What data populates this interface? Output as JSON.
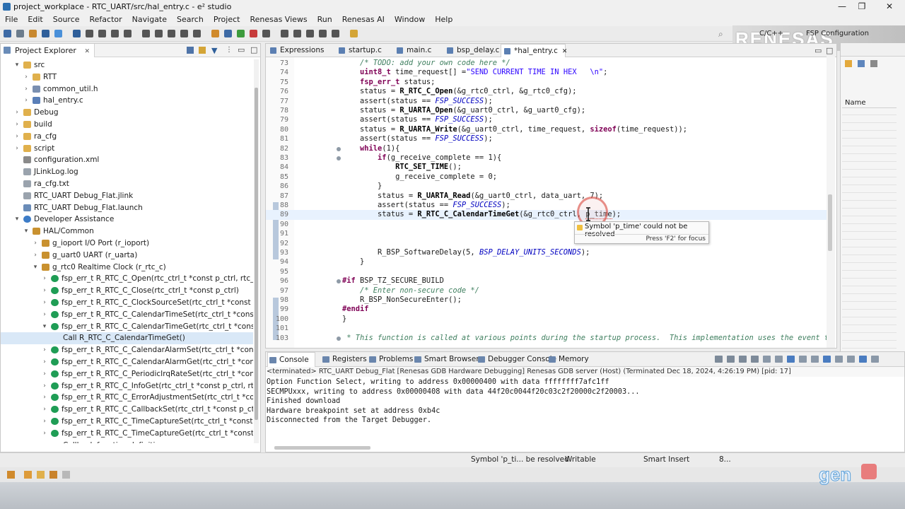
{
  "window": {
    "title": "project_workplace - RTC_UART/src/hal_entry.c - e² studio",
    "buttons": {
      "minimize": "—",
      "maximize": "❐",
      "close": "✕"
    }
  },
  "menu": [
    "File",
    "Edit",
    "Source",
    "Refactor",
    "Navigate",
    "Search",
    "Project",
    "Renesas Views",
    "Run",
    "Renesas AI",
    "Window",
    "Help"
  ],
  "perspectives": {
    "cpp": "C/C++",
    "fsp": "FSP Configuration"
  },
  "brand": {
    "logo": "RENESAS",
    "watermark": "gen"
  },
  "explorer": {
    "tab": "Project Explorer",
    "items": [
      {
        "label": "src",
        "indent": 1,
        "arrow": "▾",
        "icon": "folder-icon"
      },
      {
        "label": "RTT",
        "indent": 2,
        "arrow": "›",
        "icon": "folder-icon"
      },
      {
        "label": "common_util.h",
        "indent": 2,
        "arrow": "›",
        "icon": "header-file-icon"
      },
      {
        "label": "hal_entry.c",
        "indent": 2,
        "arrow": "›",
        "icon": "c-file-icon"
      },
      {
        "label": "Debug",
        "indent": 1,
        "arrow": "›",
        "icon": "folder-icon"
      },
      {
        "label": "build",
        "indent": 1,
        "arrow": "›",
        "icon": "folder-icon"
      },
      {
        "label": "ra_cfg",
        "indent": 1,
        "arrow": "›",
        "icon": "folder-icon"
      },
      {
        "label": "script",
        "indent": 1,
        "arrow": "›",
        "icon": "folder-icon"
      },
      {
        "label": "configuration.xml",
        "indent": 1,
        "arrow": "",
        "icon": "xml-file-icon"
      },
      {
        "label": "JLinkLog.log",
        "indent": 1,
        "arrow": "",
        "icon": "file-icon"
      },
      {
        "label": "ra_cfg.txt",
        "indent": 1,
        "arrow": "",
        "icon": "file-icon"
      },
      {
        "label": "RTC_UART Debug_Flat.jlink",
        "indent": 1,
        "arrow": "",
        "icon": "file-icon"
      },
      {
        "label": "RTC_UART Debug_Flat.launch",
        "indent": 1,
        "arrow": "",
        "icon": "launch-file-icon"
      },
      {
        "label": "Developer Assistance",
        "indent": 1,
        "arrow": "▾",
        "icon": "help-icon"
      },
      {
        "label": "HAL/Common",
        "indent": 2,
        "arrow": "▾",
        "icon": "gear-icon"
      },
      {
        "label": "g_ioport I/O Port (r_ioport)",
        "indent": 3,
        "arrow": "›",
        "icon": "gear-icon"
      },
      {
        "label": "g_uart0 UART (r_uarta)",
        "indent": 3,
        "arrow": "›",
        "icon": "gear-icon"
      },
      {
        "label": "g_rtc0 Realtime Clock (r_rtc_c)",
        "indent": 3,
        "arrow": "▾",
        "icon": "gear-icon"
      },
      {
        "label": "fsp_err_t R_RTC_C_Open(rtc_ctrl_t *const p_ctrl, rtc_cfg_t const",
        "indent": 4,
        "arrow": "›",
        "icon": "function-icon"
      },
      {
        "label": "fsp_err_t R_RTC_C_Close(rtc_ctrl_t *const p_ctrl)",
        "indent": 4,
        "arrow": "›",
        "icon": "function-icon"
      },
      {
        "label": "fsp_err_t R_RTC_C_ClockSourceSet(rtc_ctrl_t *const p_ctrl)",
        "indent": 4,
        "arrow": "›",
        "icon": "function-icon"
      },
      {
        "label": "fsp_err_t R_RTC_C_CalendarTimeSet(rtc_ctrl_t *const p_ctrl, rtc_",
        "indent": 4,
        "arrow": "›",
        "icon": "function-icon"
      },
      {
        "label": "fsp_err_t R_RTC_C_CalendarTimeGet(rtc_ctrl_t *const p_ctrl, rtc_",
        "indent": 4,
        "arrow": "▾",
        "icon": "function-icon"
      },
      {
        "label": "Call R_RTC_C_CalendarTimeGet()",
        "indent": 5,
        "arrow": "",
        "icon": "",
        "selected": true
      },
      {
        "label": "fsp_err_t R_RTC_C_CalendarAlarmSet(rtc_ctrl_t *const p_ctrl, rtc",
        "indent": 4,
        "arrow": "›",
        "icon": "function-icon"
      },
      {
        "label": "fsp_err_t R_RTC_C_CalendarAlarmGet(rtc_ctrl_t *const p_ctrl, rtc",
        "indent": 4,
        "arrow": "›",
        "icon": "function-icon"
      },
      {
        "label": "fsp_err_t R_RTC_C_PeriodicIrqRateSet(rtc_ctrl_t *const p_ctrl, rtc",
        "indent": 4,
        "arrow": "›",
        "icon": "function-icon"
      },
      {
        "label": "fsp_err_t R_RTC_C_InfoGet(rtc_ctrl_t *const p_ctrl, rtc_info_t *co",
        "indent": 4,
        "arrow": "›",
        "icon": "function-icon"
      },
      {
        "label": "fsp_err_t R_RTC_C_ErrorAdjustmentSet(rtc_ctrl_t *const p_ctrl, r",
        "indent": 4,
        "arrow": "›",
        "icon": "function-icon"
      },
      {
        "label": "fsp_err_t R_RTC_C_CallbackSet(rtc_ctrl_t *const p_ctrl, void(*p_",
        "indent": 4,
        "arrow": "›",
        "icon": "function-icon"
      },
      {
        "label": "fsp_err_t R_RTC_C_TimeCaptureSet(rtc_ctrl_t *const p_ctrl, rtc_t",
        "indent": 4,
        "arrow": "›",
        "icon": "function-icon"
      },
      {
        "label": "fsp_err_t R_RTC_C_TimeCaptureGet(rtc_ctrl_t *const p_ctrl, rtc_t",
        "indent": 4,
        "arrow": "›",
        "icon": "function-icon"
      },
      {
        "label": "Callback function definition",
        "indent": 5,
        "arrow": "",
        "icon": ""
      }
    ]
  },
  "editor": {
    "tabs": [
      "Expressions",
      "startup.c",
      "main.c",
      "bsp_delay.c",
      "*hal_entry.c"
    ],
    "active_tab": 4,
    "close_glyph": "✕",
    "lines": [
      {
        "n": "73",
        "text": "    /* TODO: add your own code here */"
      },
      {
        "n": "74",
        "text": "    uint8_t time_request[] =\"SEND CURRENT TIME IN HEX   \\n\";"
      },
      {
        "n": "75",
        "text": "    fsp_err_t status;"
      },
      {
        "n": "76",
        "text": "    status = R_RTC_C_Open(&g_rtc0_ctrl, &g_rtc0_cfg);"
      },
      {
        "n": "77",
        "text": "    assert(status == FSP_SUCCESS);"
      },
      {
        "n": "78",
        "text": "    status = R_UARTA_Open(&g_uart0_ctrl, &g_uart0_cfg);"
      },
      {
        "n": "79",
        "text": "    assert(status == FSP_SUCCESS);"
      },
      {
        "n": "80",
        "text": "    status = R_UARTA_Write(&g_uart0_ctrl, time_request, sizeof(time_request));"
      },
      {
        "n": "81",
        "text": "    assert(status == FSP_SUCCESS);"
      },
      {
        "n": "82",
        "text": "    while(1){"
      },
      {
        "n": "83",
        "text": "        if(g_receive_complete == 1){"
      },
      {
        "n": "84",
        "text": "            RTC_SET_TIME();"
      },
      {
        "n": "85",
        "text": "            g_receive_complete = 0;"
      },
      {
        "n": "86",
        "text": "        }"
      },
      {
        "n": "87",
        "text": "        status = R_UARTA_Read(&g_uart0_ctrl, data_uart, 7);"
      },
      {
        "n": "88",
        "text": "        assert(status == FSP_SUCCESS);"
      },
      {
        "n": "89",
        "text": "        status = R_RTC_C_CalendarTimeGet(&g_rtc0_ctrl, p_time);"
      },
      {
        "n": "90",
        "text": ""
      },
      {
        "n": "91",
        "text": ""
      },
      {
        "n": "92",
        "text": ""
      },
      {
        "n": "93",
        "text": "        R_BSP_SoftwareDelay(5, BSP_DELAY_UNITS_SECONDS);"
      },
      {
        "n": "94",
        "text": "    }"
      },
      {
        "n": "95",
        "text": ""
      },
      {
        "n": "96",
        "text": "#if BSP_TZ_SECURE_BUILD"
      },
      {
        "n": "97",
        "text": "    /* Enter non-secure code */"
      },
      {
        "n": "98",
        "text": "    R_BSP_NonSecureEnter();"
      },
      {
        "n": "99",
        "text": "#endif"
      },
      {
        "n": "100",
        "text": "}"
      },
      {
        "n": "101",
        "text": ""
      },
      {
        "n": "103",
        "text": " * This function is called at various points during the startup process.  This implementation uses the event that"
      }
    ],
    "hover": {
      "message": "Symbol 'p_time' could not be resolved",
      "hint": "Press 'F2' for focus"
    }
  },
  "outline": {
    "column": "Name"
  },
  "console": {
    "tabs": [
      "Console",
      "Registers",
      "Problems",
      "Smart Browser",
      "Debugger Console",
      "Memory"
    ],
    "status": "<terminated> RTC_UART Debug_Flat [Renesas GDB Hardware Debugging] Renesas GDB server (Host) (Terminated Dec 18, 2024, 4:26:19 PM) [pid: 17]",
    "lines": [
      "Option Function Select, writing to address 0x00000400 with data ffffffff7afc1ff",
      "SECMPUxxx, writing to address 0x00000408 with data 44f20c0044f20c03c2f20000c2f20003...",
      "Finished download",
      "Hardware breakpoint set at address 0xb4c",
      "Disconnected from the Target Debugger."
    ]
  },
  "statusbar": {
    "problem": "Symbol 'p_ti... be resolved",
    "writable": "Writable",
    "insert_mode": "Smart Insert",
    "position": "8..."
  }
}
